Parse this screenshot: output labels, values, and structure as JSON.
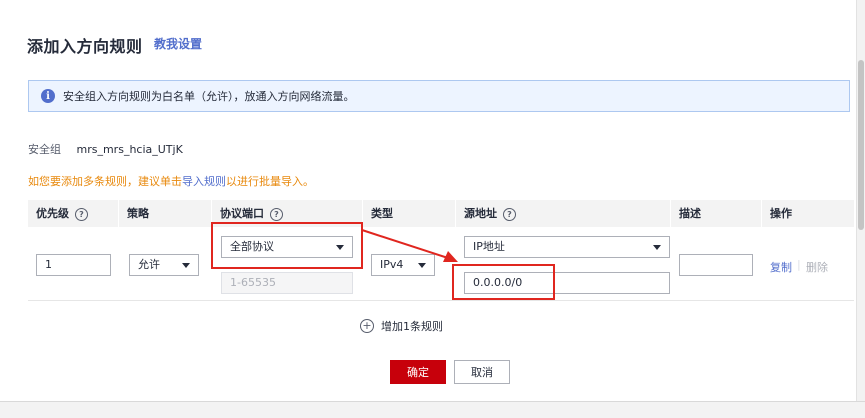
{
  "dialog": {
    "title": "添加入方向规则",
    "help_link": "教我设置",
    "close_glyph": "✕"
  },
  "info": {
    "icon_glyph": "i",
    "text": "安全组入方向规则为白名单（允许），放通入方向网络流量。"
  },
  "security_group": {
    "label": "安全组",
    "value": "mrs_mrs_hcia_UTjK"
  },
  "tip": {
    "prefix": "如您要添加多条规则，建议单击",
    "link": "导入规则",
    "suffix": "以进行批量导入。"
  },
  "table": {
    "headers": {
      "priority": "优先级",
      "policy": "策略",
      "protocol_port": "协议端口",
      "type": "类型",
      "source": "源地址",
      "description": "描述",
      "actions": "操作"
    },
    "help_glyph": "?",
    "row": {
      "priority": "1",
      "policy": "允许",
      "protocol": "全部协议",
      "port_placeholder": "1-65535",
      "type": "IPv4",
      "source_type": "IP地址",
      "source_value": "0.0.0.0/0",
      "description": "",
      "copy": "复制",
      "delete": "删除",
      "separator": "|"
    }
  },
  "add_rule": {
    "glyph": "+",
    "label": "增加1条规则"
  },
  "buttons": {
    "confirm": "确定",
    "cancel": "取消"
  },
  "colors": {
    "primary": "#c7000b",
    "link": "#526ecc",
    "warning": "#e8890d",
    "annotation": "#e0261f"
  }
}
